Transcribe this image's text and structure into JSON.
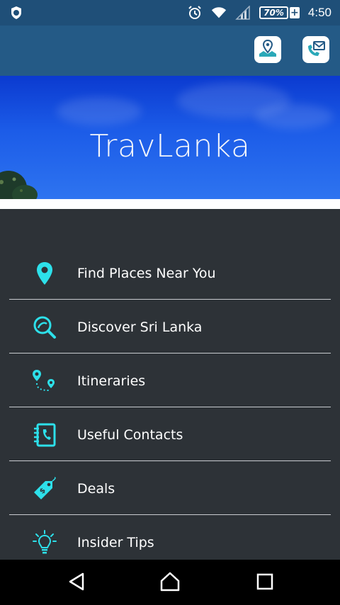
{
  "status_bar": {
    "battery_percent": "70%",
    "battery_plus": "+",
    "time": "4:50",
    "icons": [
      "vpn-shield-icon",
      "alarm-icon",
      "wifi-icon",
      "signal-icon",
      "battery-icon"
    ]
  },
  "app_bar": {
    "buttons": [
      "map-location-icon",
      "contact-mail-icon"
    ]
  },
  "banner": {
    "title": "TravLanka"
  },
  "menu": {
    "items": [
      {
        "label": "Find Places Near You",
        "icon": "location-pin-icon"
      },
      {
        "label": "Discover Sri Lanka",
        "icon": "discover-search-icon"
      },
      {
        "label": "Itineraries",
        "icon": "route-icon"
      },
      {
        "label": "Useful Contacts",
        "icon": "contact-book-icon"
      },
      {
        "label": "Deals",
        "icon": "price-tag-icon"
      },
      {
        "label": "Insider Tips",
        "icon": "lightbulb-icon"
      }
    ]
  },
  "nav_bar": {
    "buttons": [
      "back-icon",
      "home-icon",
      "recents-icon"
    ]
  },
  "colors": {
    "status_bar": "#1f4f78",
    "app_bar": "#245a86",
    "menu_bg": "#2d3237",
    "accent_icon": "#2de0ea",
    "divider": "#c9ccd0"
  }
}
